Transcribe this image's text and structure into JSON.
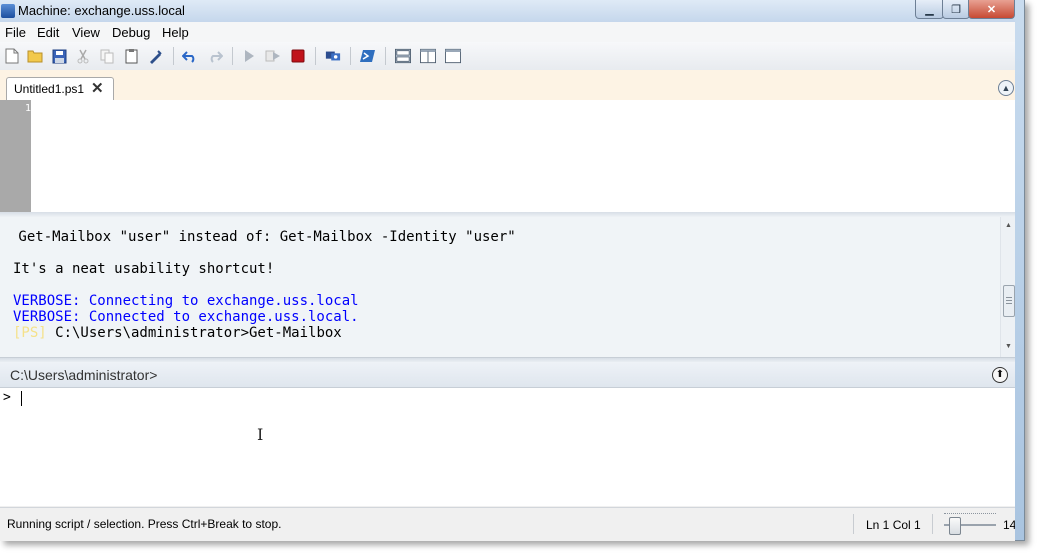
{
  "window": {
    "title": "Machine: exchange.uss.local",
    "minimize": "▁",
    "maximize": "❐",
    "close": "✕"
  },
  "menu": [
    "File",
    "Edit",
    "View",
    "Debug",
    "Help"
  ],
  "toolbar": {
    "icons": [
      "new-icon",
      "open-icon",
      "save-icon",
      "cut-icon",
      "copy-icon",
      "paste-icon",
      "clear-icon",
      "undo-icon",
      "redo-icon",
      "run-icon",
      "run-selection-icon",
      "stop-icon",
      "remote-powershell-icon",
      "powershell-icon",
      "layout-top-icon",
      "layout-right-icon",
      "layout-max-icon"
    ]
  },
  "tab": {
    "label": "Untitled1.ps1",
    "close": "✕"
  },
  "editor": {
    "line_number": "1"
  },
  "output": {
    "lines": [
      {
        "text": " Get-Mailbox \"user\" instead of: Get-Mailbox -Identity \"user\""
      },
      {
        "text": "It's a neat usability shortcut!"
      },
      {
        "text": "VERBOSE: Connecting to exchange.uss.local"
      },
      {
        "text": "VERBOSE: Connected to exchange.uss.local."
      },
      {
        "ps": "[PS]",
        "text": " C:\\Users\\administrator>Get-Mailbox"
      }
    ]
  },
  "prompt_bar": {
    "path": "C:\\Users\\administrator>"
  },
  "command": {
    "prompt": ">"
  },
  "status": {
    "message": "Running script / selection.  Press Ctrl+Break to stop.",
    "ln_col": "Ln 1  Col 1",
    "zoom": "14",
    "zoom_fraction": 0.2
  }
}
